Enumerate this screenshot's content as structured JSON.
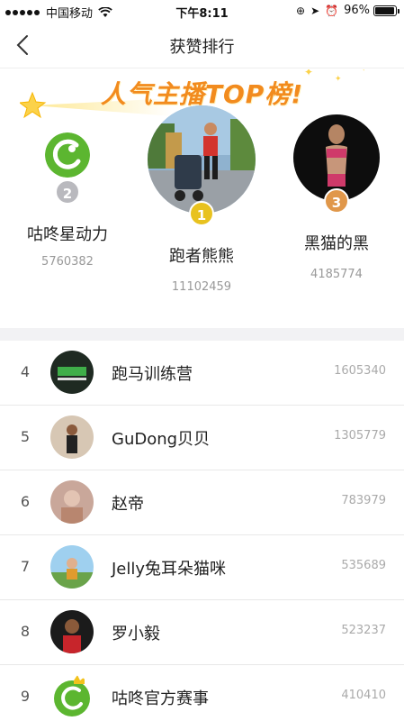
{
  "status_bar": {
    "carrier": "中国移动",
    "time": "下午8:11",
    "battery": "96%",
    "battery_level": 0.96
  },
  "nav": {
    "title": "获赞排行",
    "back_icon": "chevron-left-icon"
  },
  "banner": {
    "text": "人气主播TOP榜!"
  },
  "podium": [
    {
      "rank": "1",
      "name": "跑者熊熊",
      "score": "11102459",
      "medal_color": "#e8c21f"
    },
    {
      "rank": "2",
      "name": "咕咚星动力",
      "score": "5760382",
      "medal_color": "#b9b9be"
    },
    {
      "rank": "3",
      "name": "黑猫的黑",
      "score": "4185774",
      "medal_color": "#e0974a"
    }
  ],
  "list": [
    {
      "rank": "4",
      "name": "跑马训练营",
      "score": "1605340"
    },
    {
      "rank": "5",
      "name": "GuDong贝贝",
      "score": "1305779"
    },
    {
      "rank": "6",
      "name": "赵帝",
      "score": "783979"
    },
    {
      "rank": "7",
      "name": "Jelly兔耳朵猫咪",
      "score": "535689"
    },
    {
      "rank": "8",
      "name": "罗小毅",
      "score": "523237"
    },
    {
      "rank": "9",
      "name": "咕咚官方赛事",
      "score": "410410"
    }
  ],
  "colors": {
    "accent": "#f28b1e",
    "brand_green": "#5cb630"
  }
}
